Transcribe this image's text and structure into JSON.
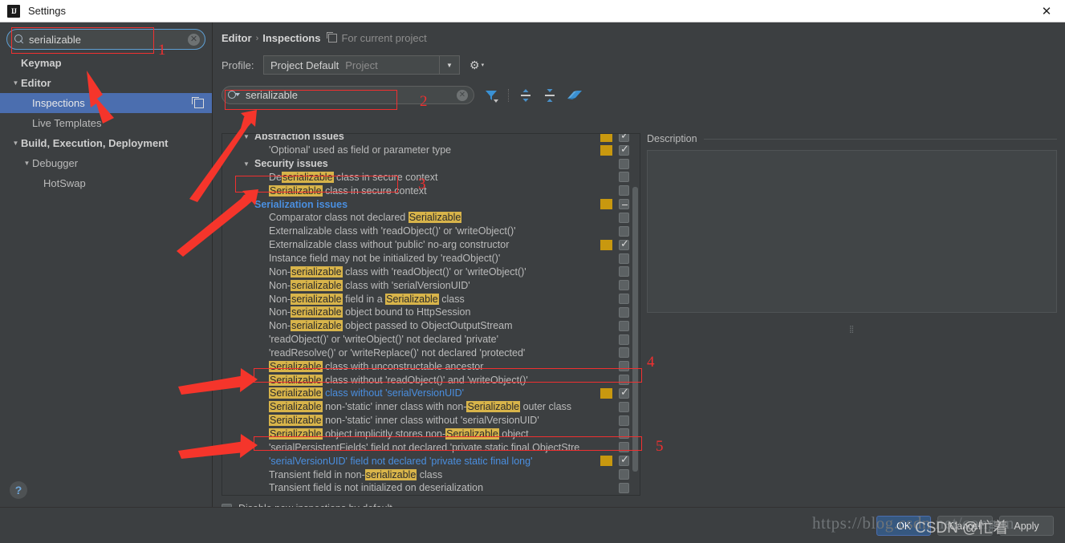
{
  "window": {
    "title": "Settings",
    "logo_text": "IJ",
    "close_label": "✕"
  },
  "sidebar": {
    "search": {
      "value": "serializable",
      "placeholder": "Search settings",
      "clear_label": "✕"
    },
    "items": [
      {
        "label": "Keymap",
        "indent": 1,
        "bold": true,
        "tri": "",
        "selected": false
      },
      {
        "label": "Editor",
        "indent": 0,
        "bold": true,
        "tri": "▼",
        "selected": false
      },
      {
        "label": "Inspections",
        "indent": 2,
        "bold": false,
        "tri": "",
        "selected": true
      },
      {
        "label": "Live Templates",
        "indent": 2,
        "bold": false,
        "tri": "",
        "selected": false
      },
      {
        "label": "Build, Execution, Deployment",
        "indent": 0,
        "bold": true,
        "tri": "▼",
        "selected": false
      },
      {
        "label": "Debugger",
        "indent": 1,
        "bold": false,
        "tri": "▼",
        "selected": false
      },
      {
        "label": "HotSwap",
        "indent": 3,
        "bold": false,
        "tri": "",
        "selected": false
      }
    ],
    "help_label": "?"
  },
  "content": {
    "breadcrumb": {
      "root": "Editor",
      "sep": "›",
      "leaf": "Inspections",
      "note": "For current project"
    },
    "profile": {
      "label": "Profile:",
      "value": "Project Default",
      "scope": "Project",
      "arrow": "▼",
      "gear": "⚙",
      "gear_caret": "▾"
    },
    "list_search": {
      "value": "serializable",
      "placeholder": "Search inspections",
      "clear_label": "✕"
    },
    "toolbar_icons": [
      "filter-icon",
      "expand-all-icon",
      "collapse-all-icon",
      "reset-icon"
    ],
    "disable_new": {
      "label": "Disable new inspections by default",
      "checked": false
    },
    "description": {
      "title": "Description",
      "body": ""
    }
  },
  "inspections": [
    {
      "type": "group",
      "label": "Abstraction issues",
      "sev": true,
      "check": "checked",
      "partial_top": true
    },
    {
      "type": "item",
      "label": "'Optional' used as field or parameter type",
      "sev": true,
      "check": "checked"
    },
    {
      "type": "group",
      "label": "Security issues",
      "sev": false,
      "check": "none"
    },
    {
      "type": "item",
      "label": "Deserializable class in secure context",
      "hl": [
        "serializable"
      ],
      "sev": false,
      "check": "none"
    },
    {
      "type": "item",
      "label": "Serializable class in secure context",
      "hl": [
        "Serializable"
      ],
      "sev": false,
      "check": "none"
    },
    {
      "type": "group",
      "label": "Serialization issues",
      "sev": true,
      "check": "partial",
      "active": true
    },
    {
      "type": "item",
      "label": "Comparator class not declared Serializable",
      "hl": [
        "Serializable"
      ],
      "sev": false,
      "check": "none"
    },
    {
      "type": "item",
      "label": "Externalizable class with 'readObject()' or 'writeObject()'",
      "sev": false,
      "check": "none"
    },
    {
      "type": "item",
      "label": "Externalizable class without 'public' no-arg constructor",
      "sev": true,
      "check": "checked"
    },
    {
      "type": "item",
      "label": "Instance field may not be initialized by 'readObject()'",
      "sev": false,
      "check": "none"
    },
    {
      "type": "item",
      "label": "Non-serializable class with 'readObject()' or 'writeObject()'",
      "hl": [
        "serializable"
      ],
      "sev": false,
      "check": "none"
    },
    {
      "type": "item",
      "label": "Non-serializable class with 'serialVersionUID'",
      "hl": [
        "serializable"
      ],
      "sev": false,
      "check": "none"
    },
    {
      "type": "item",
      "label": "Non-serializable field in a Serializable class",
      "hl": [
        "serializable",
        "Serializable"
      ],
      "sev": false,
      "check": "none"
    },
    {
      "type": "item",
      "label": "Non-serializable object bound to HttpSession",
      "hl": [
        "serializable"
      ],
      "sev": false,
      "check": "none"
    },
    {
      "type": "item",
      "label": "Non-serializable object passed to ObjectOutputStream",
      "hl": [
        "serializable"
      ],
      "sev": false,
      "check": "none"
    },
    {
      "type": "item",
      "label": "'readObject()' or 'writeObject()' not declared 'private'",
      "sev": false,
      "check": "none"
    },
    {
      "type": "item",
      "label": "'readResolve()' or 'writeReplace()' not declared 'protected'",
      "sev": false,
      "check": "none"
    },
    {
      "type": "item",
      "label": "Serializable class with unconstructable ancestor",
      "hl": [
        "Serializable"
      ],
      "sev": false,
      "check": "none"
    },
    {
      "type": "item",
      "label": "Serializable class without 'readObject()' and 'writeObject()'",
      "hl": [
        "Serializable"
      ],
      "sev": false,
      "check": "none"
    },
    {
      "type": "item",
      "label": "Serializable class without 'serialVersionUID'",
      "hl": [
        "Serializable"
      ],
      "sev": true,
      "check": "checked",
      "blue": true
    },
    {
      "type": "item",
      "label": "Serializable non-'static' inner class with non-Serializable outer class",
      "hl": [
        "Serializable",
        "Serializable"
      ],
      "sev": false,
      "check": "none"
    },
    {
      "type": "item",
      "label": "Serializable non-'static' inner class without 'serialVersionUID'",
      "hl": [
        "Serializable"
      ],
      "sev": false,
      "check": "none"
    },
    {
      "type": "item",
      "label": "Serializable object implicitly stores non-Serializable object",
      "hl": [
        "Serializable",
        "Serializable"
      ],
      "sev": false,
      "check": "none"
    },
    {
      "type": "item",
      "label": "'serialPersistentFields' field not declared 'private static final ObjectStre",
      "sev": false,
      "check": "none"
    },
    {
      "type": "item",
      "label": "'serialVersionUID' field not declared 'private static final long'",
      "sev": true,
      "check": "checked",
      "blue": true
    },
    {
      "type": "item",
      "label": "Transient field in non-serializable class",
      "hl": [
        "serializable"
      ],
      "sev": false,
      "check": "none"
    },
    {
      "type": "item",
      "label": "Transient field is not initialized on deserialization",
      "sev": false,
      "check": "none"
    }
  ],
  "footer": {
    "ok": "OK",
    "cancel": "Cancel",
    "apply": "Apply",
    "watermark": "https://blog.csdn.net/congun",
    "watermark2": "CSDN @忙着"
  },
  "annotations": [
    {
      "num": "1"
    },
    {
      "num": "2"
    },
    {
      "num": "3"
    },
    {
      "num": "4"
    },
    {
      "num": "5"
    }
  ],
  "colors": {
    "accent_blue": "#4b6eaf",
    "highlight_yellow": "#d8b44a",
    "severity_gold": "#c8980f",
    "annotation_red": "#f03030",
    "link_blue": "#4a8fe0"
  }
}
